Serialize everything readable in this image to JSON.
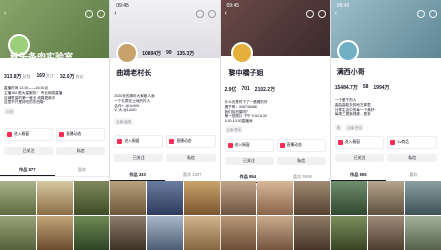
{
  "phones": [
    {
      "status_time": "",
      "name": "秋子条肉实验室",
      "id_text": "",
      "stats": [
        {
          "value": "313.8万",
          "label": "获赞"
        },
        {
          "value": "169",
          "label": "关注"
        },
        {
          "value": "32.0万",
          "label": "粉丝"
        }
      ],
      "bio_lines": [
        "直播时间 12:30——16:30点",
        "主播160 是大量服务！      专业网络直播",
        "店铺售量的第一营业      线路更新中",
        "这里不只是好吃的东西哦~"
      ],
      "chips": [
        "24岁"
      ],
      "entries": [
        "进入橱窗",
        "直播动态"
      ],
      "buttons": [
        "已关注",
        "私信"
      ],
      "tabs": [
        "作品 877",
        "喜欢"
      ],
      "subtabs": [],
      "videos": [
        "",
        "",
        "",
        "",
        "",
        ""
      ],
      "colors": {
        "banner": "#6f8f55",
        "avatar": "#9bd07a"
      }
    },
    {
      "status_time": "09:45",
      "name": "曲靖老村长",
      "id_text": "",
      "stats": [
        {
          "value": "10894万",
          "label": "获赞"
        },
        {
          "value": "99",
          "label": "关注"
        },
        {
          "value": "135.3万",
          "label": "粉丝"
        }
      ],
      "bio_lines": [
        "2020年的清年大家都人我",
        "一个扎根在土地的村人",
        "合作+: @1c909",
        "V: 大 @1c520"
      ],
      "chips": [
        "云南·曲靖"
      ],
      "entries": [
        "进入橱窗",
        "直播动态"
      ],
      "buttons": [
        "已关注",
        "私信"
      ],
      "tabs": [
        "作品 333",
        "喜欢 2667"
      ],
      "subtabs": [],
      "videos": [
        "",
        "",
        "",
        "",
        "",
        ""
      ],
      "colors": {
        "banner": "#e9e9ec",
        "avatar": "#c7a26b"
      }
    },
    {
      "status_time": "09:45",
      "name": "黎中橋子姐",
      "id_text": "",
      "stats": [
        {
          "value": "2.9亿",
          "label": "获赞"
        },
        {
          "value": "701",
          "label": "关注"
        },
        {
          "value": "2102.2万",
          "label": "粉丝"
        }
      ],
      "bio_lines": [
        "什么也是时下了一看看的好",
        "橘子哥：306748486",
        "我们给拍摄吗？",
        "第一拍照片 下午 9:30-6:30",
        "8:30-10:30直播间"
      ],
      "chips": [
        "云南·丽水"
      ],
      "entries": [
        "进入橱窗",
        "直播动态"
      ],
      "buttons": [
        "已关注",
        "私信"
      ],
      "tabs": [
        "作品 954",
        "喜欢 5966"
      ],
      "subtabs": [
        "瑞典精选",
        "生活日常"
      ],
      "videos": [
        "",
        "",
        "",
        "",
        "",
        ""
      ],
      "colors": {
        "banner": "#5d3e3a",
        "avatar": "#e6b03c"
      }
    },
    {
      "status_time": "09:45",
      "name": "满西小哥",
      "id_text": "",
      "stats": [
        {
          "value": "15484.7万",
          "label": "获赞"
        },
        {
          "value": "58",
          "label": "关注"
        },
        {
          "value": "1994万",
          "label": "粉丝"
        }
      ],
      "bio_lines": [
        "一个爱干的人",
        "曲曲曲能去的地方那里",
        "分享生活中的每一个美好~",
        "",
        "每周三更新视频…更多"
      ],
      "chips": [
        "男",
        "云南·西文"
      ],
      "entries": [
        "进入橱窗",
        "1v商品"
      ],
      "buttons": [
        "已关注",
        "私信"
      ],
      "tabs": [
        "作品 505",
        "喜欢"
      ],
      "subtabs": [
        "大王传奇",
        "美好时刻",
        "2024年..."
      ],
      "videos": [
        "",
        "",
        "",
        "",
        "",
        ""
      ],
      "colors": {
        "banner": "#7fa8b6",
        "avatar": "#6fb0c4"
      }
    }
  ]
}
